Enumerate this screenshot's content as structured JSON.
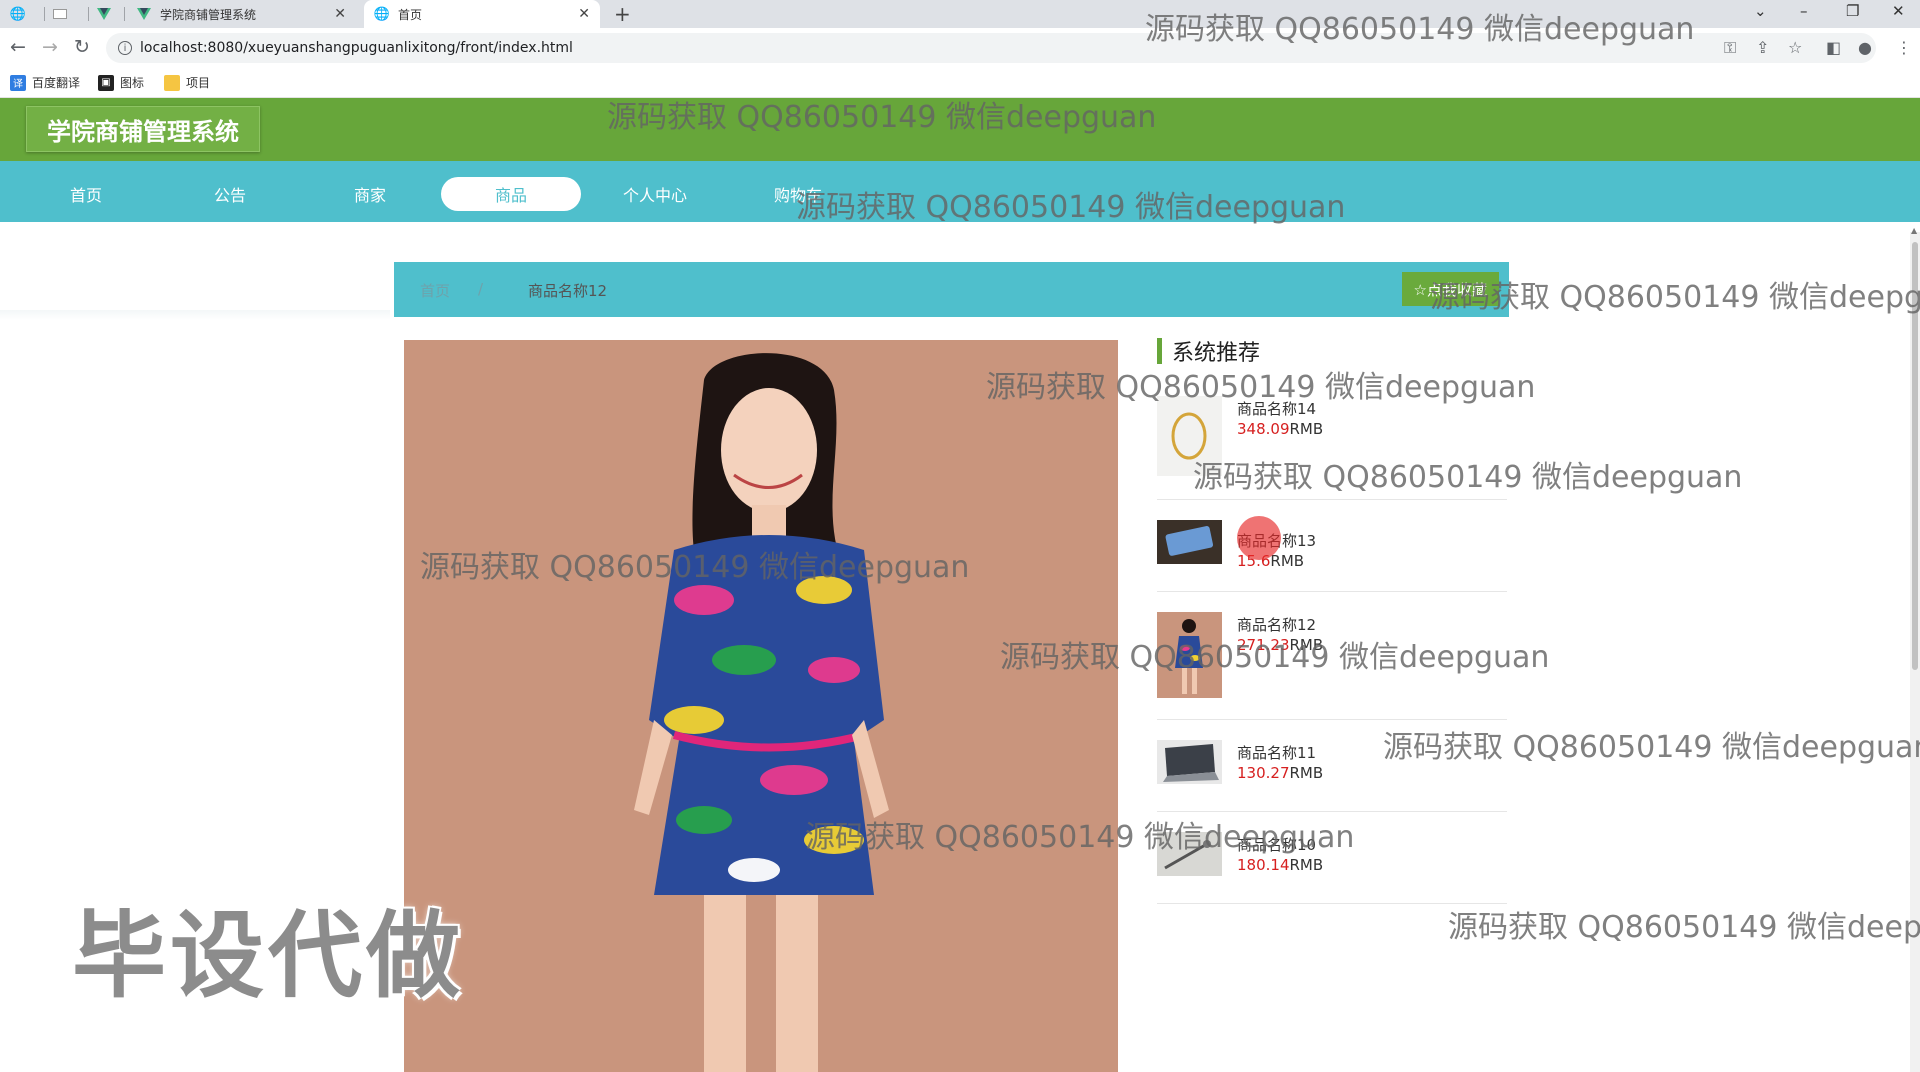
{
  "browser": {
    "tabs": [
      {
        "title": "",
        "icon": "globe-icon"
      },
      {
        "title": "",
        "icon": "blank-page-icon"
      },
      {
        "title": "",
        "icon": "vue-logo-icon"
      },
      {
        "title": "学院商铺管理系统",
        "icon": "vue-logo-icon"
      },
      {
        "title": "首页",
        "icon": "globe-icon"
      }
    ],
    "url": "localhost:8080/xueyuanshangpuguanlixitong/front/index.html",
    "bookmarks": [
      "百度翻译",
      "图标",
      "项目"
    ]
  },
  "site": {
    "title": "学院商铺管理系统",
    "nav": [
      "首页",
      "公告",
      "商家",
      "商品",
      "个人中心",
      "购物车"
    ],
    "active_nav": "商品"
  },
  "breadcrumb": {
    "home": "首页",
    "separator": "/",
    "current": "商品名称12",
    "favorite_button": "☆点我收藏"
  },
  "recommend": {
    "title": "系统推荐",
    "items": [
      {
        "name": "商品名称14",
        "price": "348.09",
        "unit": "RMB",
        "thumb": "gold-ring"
      },
      {
        "name": "商品名称13",
        "price": "15.6",
        "unit": "RMB",
        "thumb": "phone"
      },
      {
        "name": "商品名称12",
        "price": "271.23",
        "unit": "RMB",
        "thumb": "dress"
      },
      {
        "name": "商品名称11",
        "price": "130.27",
        "unit": "RMB",
        "thumb": "laptop"
      },
      {
        "name": "商品名称10",
        "price": "180.14",
        "unit": "RMB",
        "thumb": "tool"
      }
    ]
  },
  "overlay": {
    "watermark": "源码获取 QQ86050149 微信deepguan",
    "stamp": "毕设代做"
  },
  "colors": {
    "header_green": "#67a63a",
    "nav_teal": "#4fbfcc",
    "price_red": "#d62020"
  }
}
